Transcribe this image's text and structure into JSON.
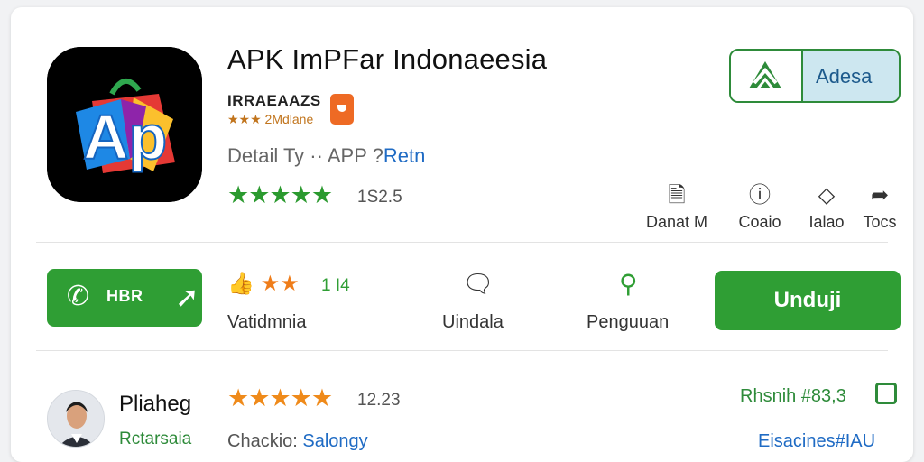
{
  "header": {
    "app_icon_letters": "Ap",
    "title": "APK ImPFar Indonaeesia",
    "developer": "IRRAEAAZS",
    "developer_sub": "★★★ 2Mdlane",
    "detail_prefix": "Detail Ty",
    "detail_mid": " ·· APP ?",
    "detail_link": "Retn",
    "rating_stars": "★★★★★",
    "rating_count": "1S2.5",
    "add_button_label": "Adesa"
  },
  "actions": [
    {
      "icon": "document-icon",
      "glyph": "🗎",
      "label": "Danat M"
    },
    {
      "icon": "info-icon",
      "glyph": "ⓘ",
      "label": "Coaio"
    },
    {
      "icon": "tag-icon",
      "glyph": "◇",
      "label": "Ialao"
    },
    {
      "icon": "share-icon",
      "glyph": "➦",
      "label": "Tocs"
    }
  ],
  "middle": {
    "call_label": "HBR",
    "call_icon": "phone-icon",
    "rating_count": "1 I4",
    "rating_label": "Vatidmnia",
    "chat_label": "Uindala",
    "user_label": "Penguuan",
    "download_label": "Unduji"
  },
  "review": {
    "name": "Pliaheg",
    "subtitle": "Rctarsaia",
    "stars": "★★★★★",
    "count": "12.23",
    "text_prefix": "Chackio: ",
    "text_link": "Salongy",
    "right_top": "Rhsnih #83,3",
    "right_bottom": "Eisacines#IAU"
  },
  "colors": {
    "green": "#2f9e34",
    "orange": "#ef8a1a",
    "link_blue": "#1f6bc4"
  }
}
